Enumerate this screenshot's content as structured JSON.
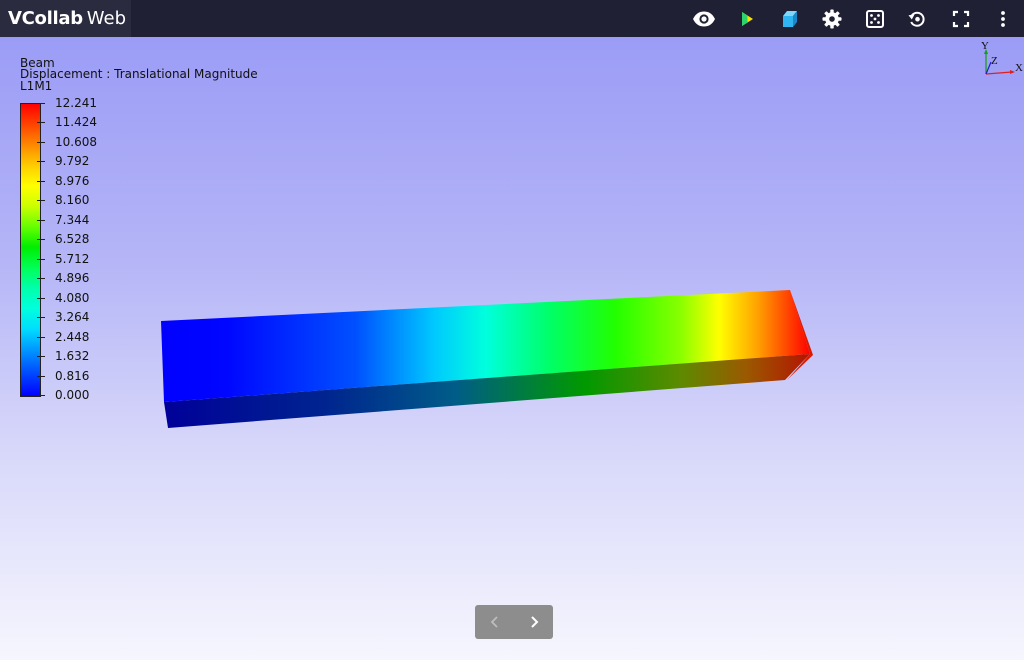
{
  "app": {
    "brand_main": "VCollab",
    "brand_sub": "Web"
  },
  "toolbar": {
    "icons": [
      "eye-icon",
      "play-icon",
      "cube-icon",
      "gear-icon",
      "dice-icon",
      "reset-view-icon",
      "fullscreen-icon",
      "more-vert-icon"
    ]
  },
  "legend": {
    "model": "Beam",
    "result": "Displacement : Translational Magnitude",
    "instance": "L1M1",
    "values": [
      "12.241",
      "11.424",
      "10.608",
      "9.792",
      "8.976",
      "8.160",
      "7.344",
      "6.528",
      "5.712",
      "4.896",
      "4.080",
      "3.264",
      "2.448",
      "1.632",
      "0.816",
      "0.000"
    ]
  },
  "triad": {
    "x": "X",
    "y": "Y",
    "z": "Z"
  },
  "colors": {
    "topbar": "#1f2033",
    "brand_bg": "#2a2b3f",
    "play": "#f5e400",
    "cube": "#2fb5f2",
    "bg_top": "#9b9cf6",
    "bg_bottom": "#f6f6fe"
  }
}
